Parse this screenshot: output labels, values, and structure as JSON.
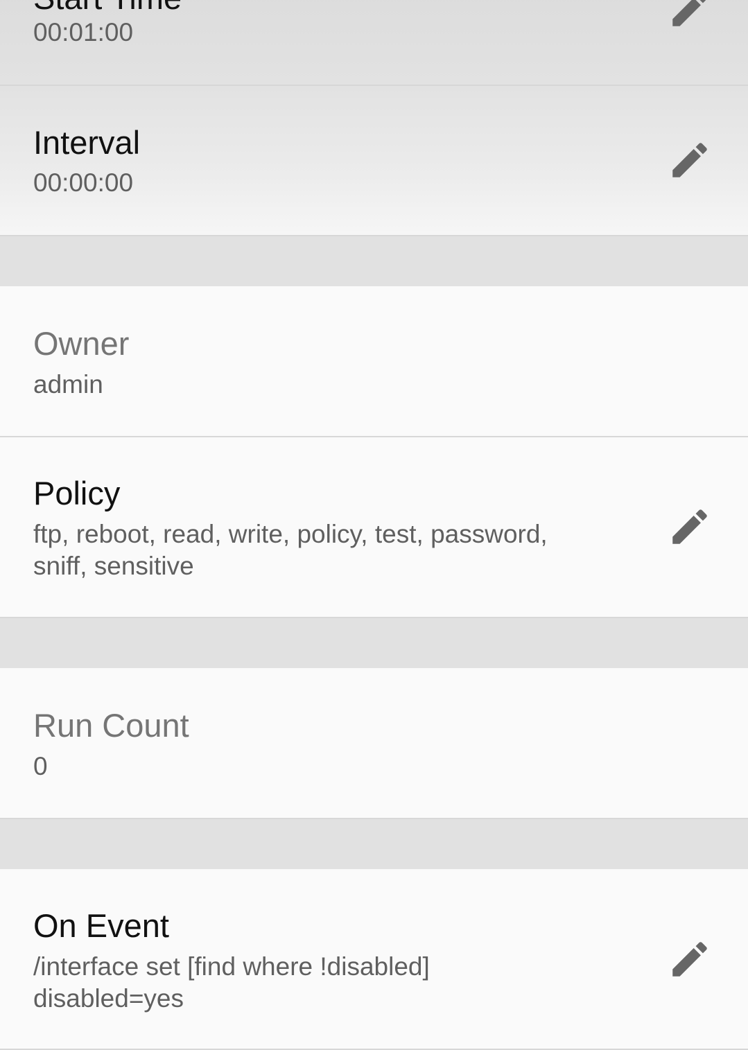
{
  "rows": {
    "start_time": {
      "title": "Start Time",
      "value": "00:01:00",
      "editable": true
    },
    "interval": {
      "title": "Interval",
      "value": "00:00:00",
      "editable": true
    },
    "owner": {
      "title": "Owner",
      "value": "admin",
      "editable": false
    },
    "policy": {
      "title": "Policy",
      "value_line1": "ftp, reboot, read, write, policy, test, password,",
      "value_line2": "sniff, sensitive",
      "editable": true
    },
    "run_count": {
      "title": "Run Count",
      "value": "0",
      "editable": false
    },
    "on_event": {
      "title": "On Event",
      "value_line1": "/interface set [find where !disabled]",
      "value_line2": "disabled=yes",
      "editable": true
    }
  },
  "icons": {
    "edit": "pencil-icon"
  },
  "colors": {
    "title": "#111111",
    "title_readonly": "#757575",
    "value": "#5f5f5f",
    "icon": "#666666",
    "section_gap": "#e1e1e1",
    "background": "#fafafa"
  }
}
